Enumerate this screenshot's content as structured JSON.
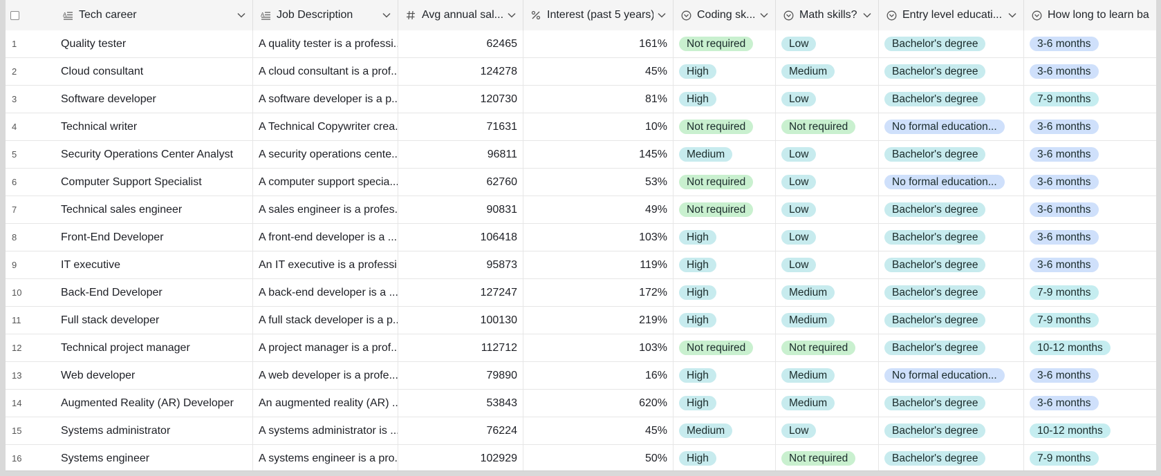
{
  "colors": {
    "not_required": "#c9f0cf",
    "teal": "#c7ebee",
    "blue": "#cfe0fb"
  },
  "headers": {
    "tech_career": "Tech career",
    "job_description": "Job Description",
    "salary": "Avg annual sal...",
    "interest": "Interest (past 5 years)",
    "coding": "Coding sk...",
    "math": "Math skills?",
    "education": "Entry level educati...",
    "learn": "How long to learn ba"
  },
  "rows": [
    {
      "n": "1",
      "career": "Quality tester",
      "desc": "A quality tester is a professi...",
      "salary": "62465",
      "interest": "161%",
      "coding": "Not required",
      "math": "Low",
      "edu": "Bachelor's degree",
      "learn": "3-6 months"
    },
    {
      "n": "2",
      "career": "Cloud consultant",
      "desc": "A cloud consultant is a prof...",
      "salary": "124278",
      "interest": "45%",
      "coding": "High",
      "math": "Medium",
      "edu": "Bachelor's degree",
      "learn": "3-6 months"
    },
    {
      "n": "3",
      "career": "Software developer",
      "desc": "A software developer is a p...",
      "salary": "120730",
      "interest": "81%",
      "coding": "High",
      "math": "Low",
      "edu": "Bachelor's degree",
      "learn": "7-9 months"
    },
    {
      "n": "4",
      "career": "Technical writer",
      "desc": "A Technical Copywriter crea...",
      "salary": "71631",
      "interest": "10%",
      "coding": "Not required",
      "math": "Not required",
      "edu": "No formal education...",
      "learn": "3-6 months"
    },
    {
      "n": "5",
      "career": "Security Operations Center Analyst",
      "desc": "A security operations cente...",
      "salary": "96811",
      "interest": "145%",
      "coding": "Medium",
      "math": "Low",
      "edu": "Bachelor's degree",
      "learn": "3-6 months"
    },
    {
      "n": "6",
      "career": "Computer Support Specialist",
      "desc": "A computer support specia...",
      "salary": "62760",
      "interest": "53%",
      "coding": "Not required",
      "math": "Low",
      "edu": "No formal education...",
      "learn": "3-6 months"
    },
    {
      "n": "7",
      "career": "Technical sales engineer",
      "desc": "A sales engineer is a profes...",
      "salary": "90831",
      "interest": "49%",
      "coding": "Not required",
      "math": "Low",
      "edu": "Bachelor's degree",
      "learn": "3-6 months"
    },
    {
      "n": "8",
      "career": "Front-End Developer",
      "desc": "A front-end developer is a ...",
      "salary": "106418",
      "interest": "103%",
      "coding": "High",
      "math": "Low",
      "edu": "Bachelor's degree",
      "learn": "3-6 months"
    },
    {
      "n": "9",
      "career": "IT executive",
      "desc": "An IT executive is a professi...",
      "salary": "95873",
      "interest": "119%",
      "coding": "High",
      "math": "Low",
      "edu": "Bachelor's degree",
      "learn": "3-6 months"
    },
    {
      "n": "10",
      "career": "Back-End Developer",
      "desc": "A back-end developer is a ...",
      "salary": "127247",
      "interest": "172%",
      "coding": "High",
      "math": "Medium",
      "edu": "Bachelor's degree",
      "learn": "7-9 months"
    },
    {
      "n": "11",
      "career": "Full stack developer",
      "desc": "A full stack developer is a p...",
      "salary": "100130",
      "interest": "219%",
      "coding": "High",
      "math": "Medium",
      "edu": "Bachelor's degree",
      "learn": "7-9 months"
    },
    {
      "n": "12",
      "career": "Technical project manager",
      "desc": "A project manager is a prof...",
      "salary": "112712",
      "interest": "103%",
      "coding": "Not required",
      "math": "Not required",
      "edu": "Bachelor's degree",
      "learn": "10-12 months"
    },
    {
      "n": "13",
      "career": "Web developer",
      "desc": "A web developer is a profe...",
      "salary": "79890",
      "interest": "16%",
      "coding": "High",
      "math": "Medium",
      "edu": "No formal education...",
      "learn": "3-6 months"
    },
    {
      "n": "14",
      "career": "Augmented Reality (AR) Developer",
      "desc": "An augmented reality (AR) ...",
      "salary": "53843",
      "interest": "620%",
      "coding": "High",
      "math": "Medium",
      "edu": "Bachelor's degree",
      "learn": "3-6 months"
    },
    {
      "n": "15",
      "career": "Systems administrator",
      "desc": "A systems administrator is ...",
      "salary": "76224",
      "interest": "45%",
      "coding": "Medium",
      "math": "Low",
      "edu": "Bachelor's degree",
      "learn": "10-12 months"
    },
    {
      "n": "16",
      "career": "Systems engineer",
      "desc": "A systems engineer is a pro...",
      "salary": "102929",
      "interest": "50%",
      "coding": "High",
      "math": "Not required",
      "edu": "Bachelor's degree",
      "learn": "7-9 months"
    }
  ]
}
